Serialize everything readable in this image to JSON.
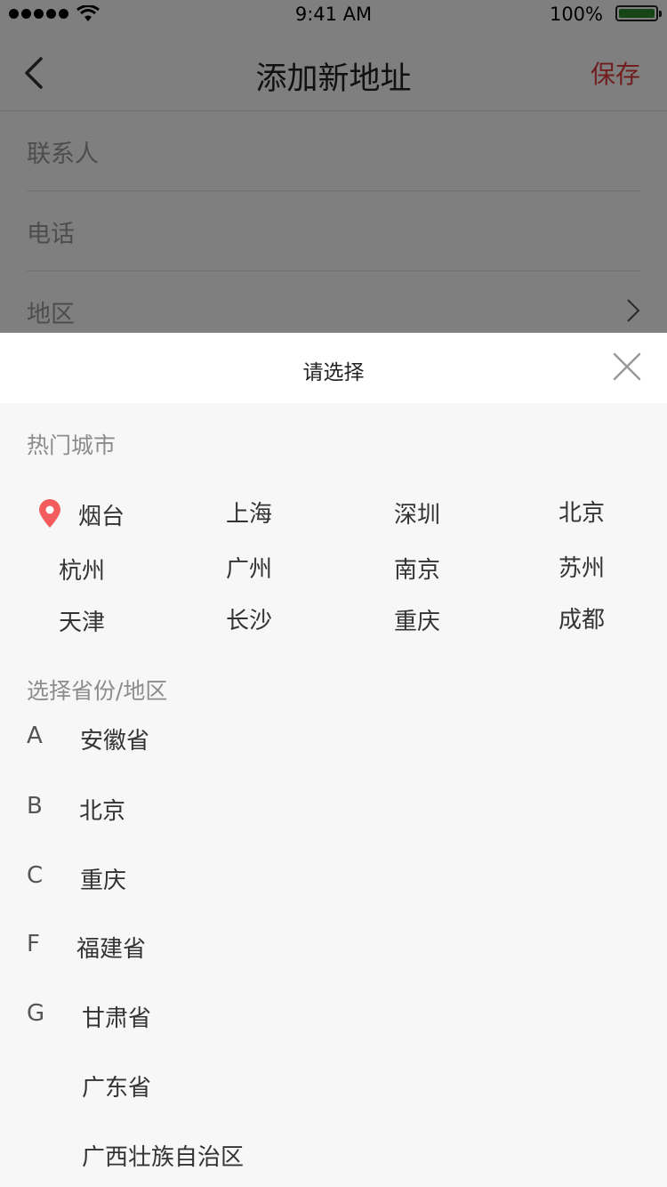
{
  "status_bar": {
    "time": "9:41 AM",
    "battery": "100%",
    "signal_icon": "signal-dots-icon",
    "wifi_icon": "wifi-icon",
    "battery_icon": "battery-icon"
  },
  "nav": {
    "title": "添加新地址",
    "save_label": "保存",
    "back_icon": "chevron-left-icon"
  },
  "form": {
    "contact_label": "联系人",
    "phone_label": "电话",
    "region_label": "地区",
    "region_chevron_icon": "chevron-right-icon"
  },
  "picker": {
    "title": "请选择",
    "close_icon": "close-icon",
    "hot_title": "热门城市",
    "location_icon": "location-pin-icon",
    "hot_cities": [
      "烟台",
      "上海",
      "深圳",
      "北京",
      "杭州",
      "广州",
      "南京",
      "苏州",
      "天津",
      "长沙",
      "重庆",
      "成都"
    ],
    "province_title": "选择省份/地区",
    "provinces": [
      {
        "letter": "A",
        "name": "安徽省"
      },
      {
        "letter": "B",
        "name": "北京"
      },
      {
        "letter": "C",
        "name": "重庆"
      },
      {
        "letter": "F",
        "name": "福建省"
      },
      {
        "letter": "G",
        "name": "甘肃省"
      },
      {
        "letter": "",
        "name": "广东省"
      },
      {
        "letter": "",
        "name": "广西壮族自治区"
      }
    ]
  },
  "colors": {
    "accent": "#e03c3c",
    "pin": "#f25c5c",
    "sheet_bg": "#f7f7f7"
  }
}
